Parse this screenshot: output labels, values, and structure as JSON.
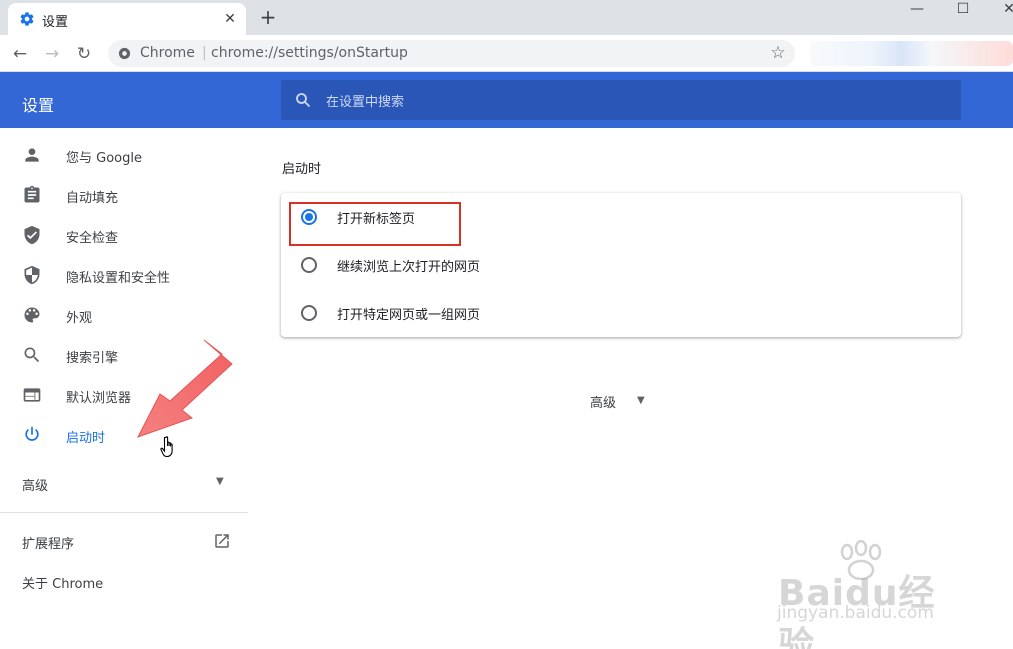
{
  "tab": {
    "title": "设置",
    "close": "✕",
    "new_tab": "+"
  },
  "window": {
    "minimize": "—",
    "maximize": "☐",
    "close": "✕"
  },
  "toolbar": {
    "back": "←",
    "forward": "→",
    "reload": "↻",
    "origin": "Chrome",
    "separator": "|",
    "url": "chrome://settings/onStartup",
    "star": "☆"
  },
  "header": {
    "title": "设置",
    "search_placeholder": "在设置中搜索"
  },
  "sidebar": {
    "items": [
      {
        "label": "您与 Google",
        "icon": "person-icon",
        "active": false
      },
      {
        "label": "自动填充",
        "icon": "clipboard-icon",
        "active": false
      },
      {
        "label": "安全检查",
        "icon": "shield-check-icon",
        "active": false
      },
      {
        "label": "隐私设置和安全性",
        "icon": "shield-half-icon",
        "active": false
      },
      {
        "label": "外观",
        "icon": "palette-icon",
        "active": false
      },
      {
        "label": "搜索引擎",
        "icon": "search-icon",
        "active": false
      },
      {
        "label": "默认浏览器",
        "icon": "browser-icon",
        "active": false
      },
      {
        "label": "启动时",
        "icon": "power-icon",
        "active": true
      }
    ],
    "advanced": "高级",
    "caret": "▼",
    "extensions": "扩展程序",
    "about": "关于 Chrome"
  },
  "main": {
    "section_title": "启动时",
    "options": [
      {
        "label": "打开新标签页",
        "checked": true
      },
      {
        "label": "继续浏览上次打开的网页",
        "checked": false
      },
      {
        "label": "打开特定网页或一组网页",
        "checked": false
      }
    ],
    "advanced": "高级",
    "caret": "▼"
  },
  "watermark": {
    "brand": "Baidu经验",
    "url": "jingyan.baidu.com"
  },
  "colors": {
    "accent": "#1a73e8",
    "header": "#3367d6",
    "search": "#2a56b8",
    "highlight": "#d93025",
    "arrow": "#f46d6d"
  }
}
